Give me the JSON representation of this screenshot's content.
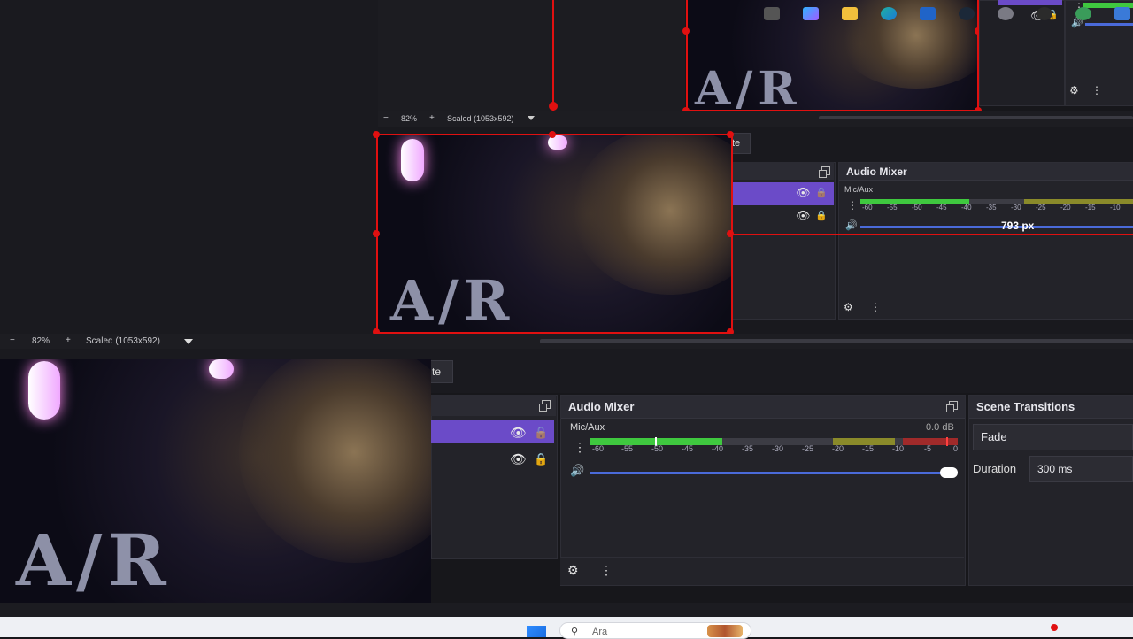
{
  "top_preview": {
    "zoom": "82%",
    "zoom_out": "−",
    "zoom_in": "+",
    "scale_mode": "Scaled (1053x592)",
    "size_readout": "793 px",
    "tab_fragment": "te"
  },
  "top_audio_mixer": {
    "title": "Audio Mixer",
    "channel": "Mic/Aux",
    "ticks": [
      "-60",
      "-55",
      "-50",
      "-45",
      "-40",
      "-35",
      "-30",
      "-25",
      "-20",
      "-15",
      "-10"
    ]
  },
  "bottom_preview": {
    "zoom": "82%",
    "zoom_out": "−",
    "zoom_in": "+",
    "scale_mode": "Scaled (1053x592)",
    "tab_fragment": "te"
  },
  "audio_mixer": {
    "title": "Audio Mixer",
    "channel": "Mic/Aux",
    "db_value": "0.0 dB",
    "ticks": [
      "-60",
      "-55",
      "-50",
      "-45",
      "-40",
      "-35",
      "-30",
      "-25",
      "-20",
      "-15",
      "-10",
      "-5",
      "0"
    ],
    "volume_level": 1.0
  },
  "scene_transitions": {
    "title": "Scene Transitions",
    "transition": "Fade",
    "duration_label": "Duration",
    "duration_value": "300 ms"
  },
  "video_overlay_text": "A/R",
  "taskbar": {
    "search_placeholder": "Ara"
  },
  "colors": {
    "accent": "#4a6ad9",
    "selection": "#e01010",
    "source_selected": "#6b4bc8",
    "meter_green": "#3fc83f"
  }
}
